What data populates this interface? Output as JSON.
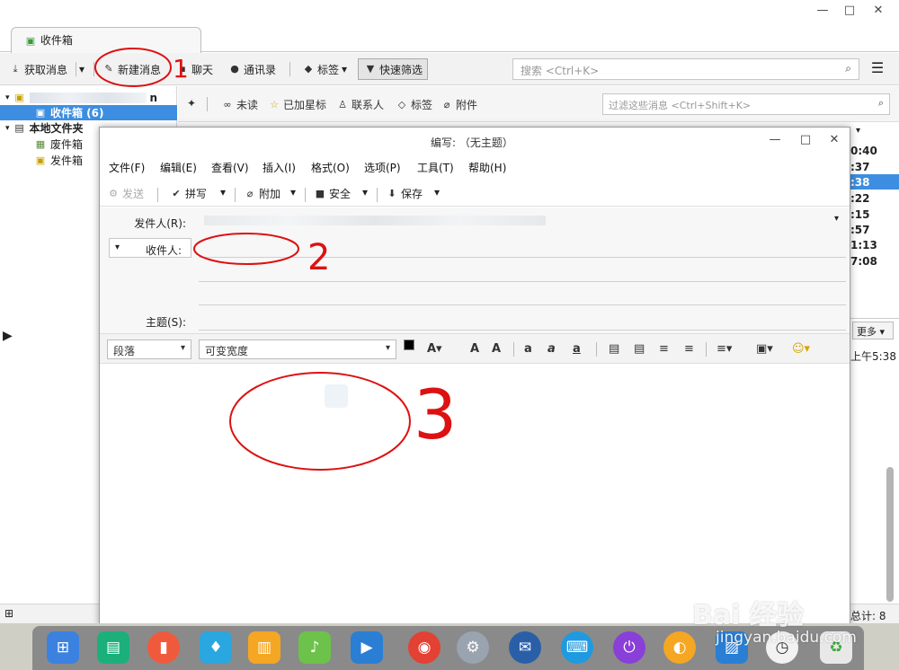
{
  "window": {
    "tab_label": "收件箱",
    "controls": {
      "minimize": "—",
      "maximize": "□",
      "close": "✕"
    }
  },
  "main_toolbar": {
    "get_messages": "获取消息",
    "new_message": "新建消息",
    "chat": "聊天",
    "address_book": "通讯录",
    "tags": "标签",
    "quick_filter": "快速筛选",
    "search_placeholder": "搜索 <Ctrl+K>"
  },
  "folder_pane": {
    "account_suffix": "n",
    "inbox": "收件箱 (6)",
    "local_folders": "本地文件夹",
    "trash": "废件箱",
    "outbox": "发件箱"
  },
  "filter_bar": {
    "unread": "未读",
    "starred": "已加星标",
    "contacts": "联系人",
    "tags": "标签",
    "attachments": "附件",
    "filter_placeholder": "过滤这些消息 <Ctrl+Shift+K>"
  },
  "message_times": [
    "0:40",
    ":37",
    ":38",
    ":22",
    ":15",
    ":57",
    "1:13",
    "7:08"
  ],
  "preview": {
    "more_button": "更多",
    "time": "上午5:38"
  },
  "status_bar": {
    "total": "总计: 8"
  },
  "compose": {
    "title": "编写: （无主题）",
    "menu": [
      "文件(F)",
      "编辑(E)",
      "查看(V)",
      "插入(I)",
      "格式(O)",
      "选项(P)",
      "工具(T)",
      "帮助(H)"
    ],
    "toolbar": {
      "send": "发送",
      "spell": "拼写",
      "attach": "附加",
      "security": "安全",
      "save": "保存"
    },
    "from_label": "发件人(R):",
    "to_label": "收件人:",
    "subject_label": "主题(S):",
    "paragraph_select": "段落",
    "font_select": "可变宽度"
  },
  "annotations": {
    "mark1": "1",
    "mark2": "2",
    "mark3": "3"
  },
  "watermark": {
    "brand": "Bai 经验",
    "url": "jingyan.baidu.com"
  },
  "colors": {
    "selection": "#3d8ee0",
    "annotation_red": "#d11111",
    "dock": "#8a8a8a"
  }
}
